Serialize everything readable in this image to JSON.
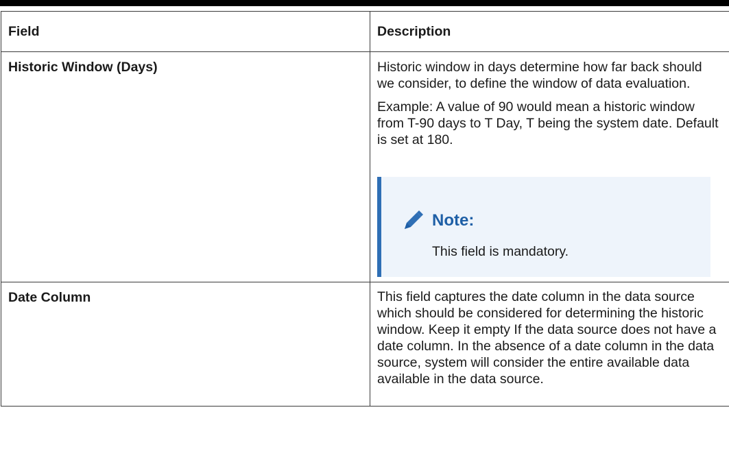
{
  "table": {
    "headers": {
      "field": "Field",
      "description": "Description"
    },
    "rows": [
      {
        "field": "Historic Window (Days)",
        "paragraphs": [
          "Historic window in days determine how far back should we consider, to define the window of data evaluation.",
          "Example: A value of 90 would mean a historic window from T-90 days to T Day, T being the system date. Default is set at 180."
        ],
        "note": {
          "icon": "pencil-icon",
          "title": "Note:",
          "text": "This field is mandatory."
        }
      },
      {
        "field": "Date Column",
        "paragraphs": [
          "This field captures the date column in the data source which should be considered for determining the historic window. Keep it empty If the data source does not have a date column. In the absence of a date column in the data source, system will consider the entire available data available in the data source."
        ]
      }
    ]
  },
  "colors": {
    "note_accent": "#2f6fb5",
    "note_background": "#eef4fb",
    "note_title": "#1e5fa6"
  }
}
